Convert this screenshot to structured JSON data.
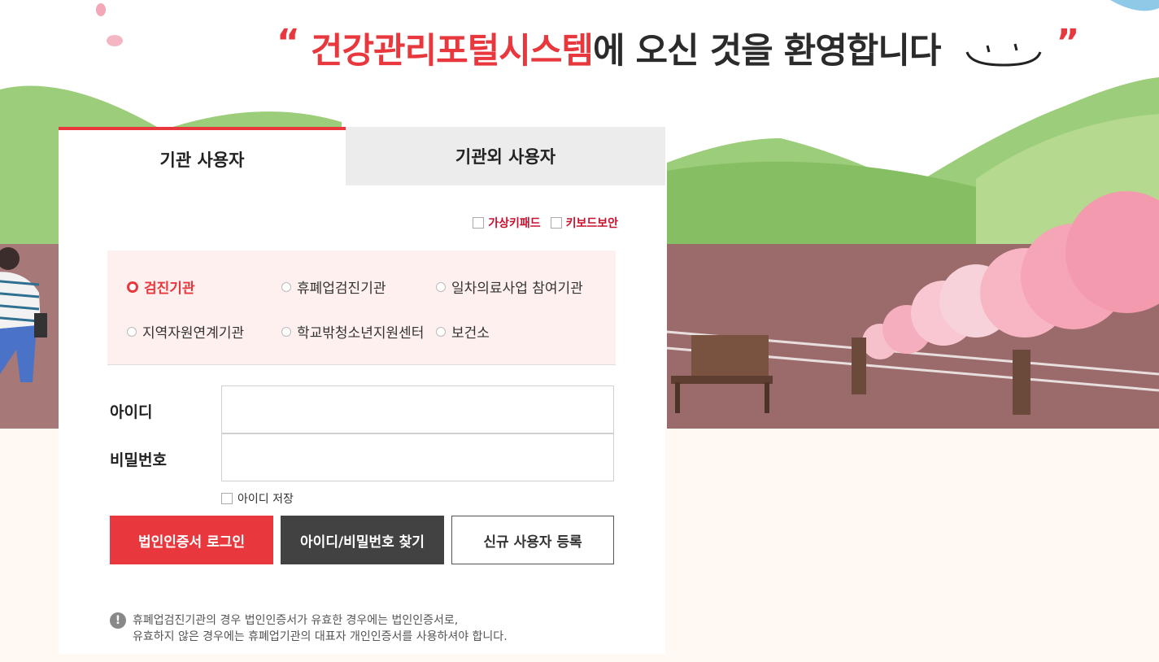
{
  "headline": {
    "open_quote": "“",
    "accent": "건강관리포털시스템",
    "rest": "에 오신 것을 환영합니다",
    "close_quote": "”"
  },
  "tabs": [
    {
      "label": "기관 사용자",
      "active": true
    },
    {
      "label": "기관외 사용자",
      "active": false
    }
  ],
  "security": {
    "virtual_keypad": "가상키패드",
    "keyboard_security": "키보드보안"
  },
  "org_types": [
    {
      "label": "검진기관",
      "selected": true
    },
    {
      "label": "휴폐업검진기관",
      "selected": false
    },
    {
      "label": "일차의료사업 참여기관",
      "selected": false
    },
    {
      "label": "지역자원연계기관",
      "selected": false
    },
    {
      "label": "학교밖청소년지원센터",
      "selected": false
    },
    {
      "label": "보건소",
      "selected": false
    }
  ],
  "login": {
    "id_label": "아이디",
    "id_value": "",
    "pw_label": "비밀번호",
    "pw_value": "",
    "save_id": "아이디 저장"
  },
  "buttons": {
    "cert_login": "법인인증서 로그인",
    "find": "아이디/비밀번호 찾기",
    "register": "신규 사용자 등록"
  },
  "notice": {
    "line1": "휴폐업검진기관의 경우 법인인증서가 유효한 경우에는 법인인증서로,",
    "line2": "유효하지 않은 경우에는 휴폐업기관의 대표자 개인인증서를 사용하셔야 합니다."
  },
  "colors": {
    "accent": "#e8383d",
    "dark_button": "#424242",
    "org_box_bg": "#fdf0ee",
    "bottom_bg": "#fff8f3"
  }
}
